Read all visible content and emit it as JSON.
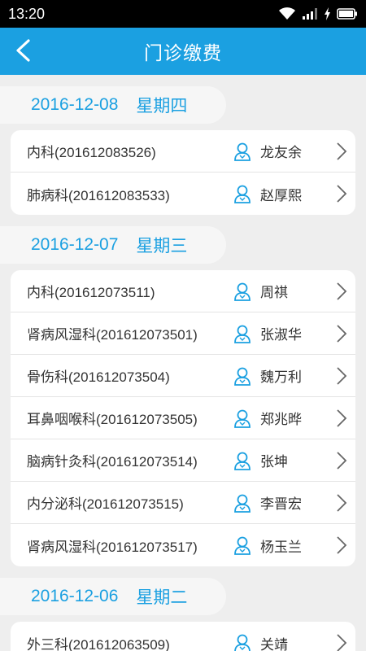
{
  "status_bar": {
    "time": "13:20"
  },
  "header": {
    "title": "门诊缴费"
  },
  "sections": [
    {
      "date": "2016-12-08",
      "weekday": "星期四",
      "rows": [
        {
          "dept": "内科(201612083526)",
          "doctor": "龙友余"
        },
        {
          "dept": "肺病科(201612083533)",
          "doctor": "赵厚熙"
        }
      ]
    },
    {
      "date": "2016-12-07",
      "weekday": "星期三",
      "rows": [
        {
          "dept": "内科(201612073511)",
          "doctor": "周祺"
        },
        {
          "dept": "肾病风湿科(201612073501)",
          "doctor": "张淑华"
        },
        {
          "dept": "骨伤科(201612073504)",
          "doctor": "魏万利"
        },
        {
          "dept": "耳鼻咽喉科(201612073505)",
          "doctor": "郑兆晔"
        },
        {
          "dept": "脑病针灸科(201612073514)",
          "doctor": "张坤"
        },
        {
          "dept": "内分泌科(201612073515)",
          "doctor": "李晋宏"
        },
        {
          "dept": "肾病风湿科(201612073517)",
          "doctor": "杨玉兰"
        }
      ]
    },
    {
      "date": "2016-12-06",
      "weekday": "星期二",
      "rows": [
        {
          "dept": "外三科(201612063509)",
          "doctor": "关靖"
        }
      ]
    }
  ],
  "colors": {
    "accent": "#1ba0e1",
    "background": "#eeeeee",
    "status_bar": "#000000"
  },
  "icons": {
    "back": "chevron-left-icon",
    "row_person": "person-icon",
    "row_arrow": "chevron-right-icon"
  }
}
